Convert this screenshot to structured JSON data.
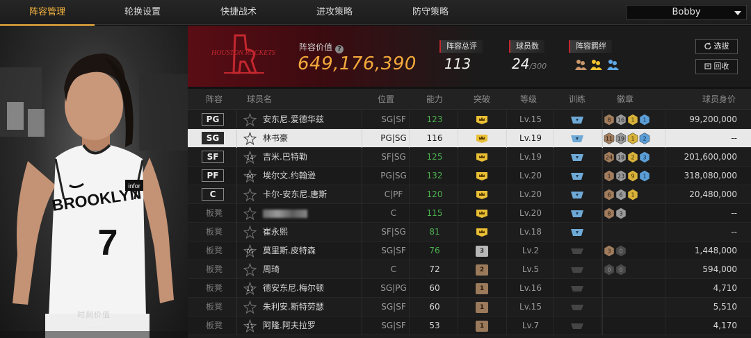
{
  "nav": {
    "tabs": [
      {
        "label": "阵容管理",
        "active": true
      },
      {
        "label": "轮换设置",
        "active": false
      },
      {
        "label": "快捷战术",
        "active": false
      },
      {
        "label": "进攻策略",
        "active": false
      },
      {
        "label": "防守策略",
        "active": false
      }
    ],
    "user": "Bobby"
  },
  "player_panel": {
    "jersey_text": "BROOKLYN",
    "jersey_number": "7",
    "logo_text": "infor",
    "value_label": "时刻价值",
    "value": "——"
  },
  "summary": {
    "logo_text": "HOUSTON ROCKETS",
    "value_title": "阵容价值",
    "value": "649,176,390",
    "overall_label": "阵容总评",
    "overall_value": "113",
    "players_label": "球员数",
    "players_value": "24",
    "players_max": "/300",
    "bond_label": "阵容羁绊",
    "btn_select": "选拔",
    "btn_recycle": "回收"
  },
  "table": {
    "headers": [
      "阵容",
      "球员名",
      "位置",
      "能力",
      "突破",
      "等级",
      "训练",
      "徽章",
      "球员身价"
    ],
    "rows": [
      {
        "slot": "PG",
        "num": "",
        "name": "安东尼.爱德华兹",
        "pos": "SG|SF",
        "rating": "123",
        "rating_color": "#4caf50",
        "breakthrough": "crown",
        "level": "Lv.15",
        "train": "blue",
        "badges": [
          [
            "8",
            "bronze"
          ],
          [
            "16",
            "silver"
          ],
          [
            "1",
            "gold"
          ],
          [
            "1",
            "blue"
          ]
        ],
        "value": "99,200,000"
      },
      {
        "slot": "SG",
        "num": "",
        "name": "林书豪",
        "pos": "PG|SG",
        "rating": "116",
        "rating_color": "#1a1a1a",
        "breakthrough": "crown",
        "level": "Lv.19",
        "train": "blue",
        "badges": [
          [
            "11",
            "bronze"
          ],
          [
            "19",
            "silver"
          ],
          [
            "1",
            "gold"
          ],
          [
            "2",
            "blue"
          ]
        ],
        "value": "--",
        "selected": true
      },
      {
        "slot": "SF",
        "num": "14",
        "name": "吉米.巴特勒",
        "pos": "SF|SG",
        "rating": "125",
        "rating_color": "#4caf50",
        "breakthrough": "crown",
        "level": "Lv.19",
        "train": "blue",
        "badges": [
          [
            "24",
            "bronze"
          ],
          [
            "18",
            "silver"
          ],
          [
            "2",
            "gold"
          ],
          [
            "3",
            "blue"
          ]
        ],
        "value": "201,600,000"
      },
      {
        "slot": "PF",
        "num": "90",
        "name": "埃尔文.约翰逊",
        "pos": "PG|SG",
        "rating": "132",
        "rating_color": "#4caf50",
        "breakthrough": "crown",
        "level": "Lv.20",
        "train": "blue",
        "badges": [
          [
            "1",
            "bronze"
          ],
          [
            "23",
            "silver"
          ],
          [
            "9",
            "gold"
          ],
          [
            "1",
            "blue"
          ]
        ],
        "value": "318,080,000"
      },
      {
        "slot": "C",
        "num": "",
        "name": "卡尔-安东尼.唐斯",
        "pos": "C|PF",
        "rating": "120",
        "rating_color": "#4caf50",
        "breakthrough": "crown",
        "level": "Lv.20",
        "train": "blue",
        "badges": [
          [
            "6",
            "bronze"
          ],
          [
            "6",
            "silver"
          ],
          [
            "1",
            "gold"
          ]
        ],
        "value": "20,480,000"
      },
      {
        "slot": "板凳",
        "num": "",
        "name": "",
        "blurred": true,
        "pos": "C",
        "rating": "115",
        "rating_color": "#4caf50",
        "breakthrough": "crown",
        "level": "Lv.20",
        "train": "blue",
        "badges": [
          [
            "8",
            "bronze"
          ],
          [
            "3",
            "silver"
          ]
        ],
        "value": "--"
      },
      {
        "slot": "板凳",
        "num": "",
        "name": "崔永熙",
        "pos": "SF|SG",
        "rating": "81",
        "rating_color": "#4caf50",
        "breakthrough": "crown",
        "level": "Lv.18",
        "train": "blue",
        "badges": [],
        "value": "--"
      },
      {
        "slot": "板凳",
        "num": "05",
        "name": "莫里斯.皮特森",
        "pos": "SG|SF",
        "rating": "76",
        "rating_color": "#4caf50",
        "breakthrough": "3",
        "bk_style": "silver",
        "level": "Lv.2",
        "train": "grey",
        "badges": [
          [
            "3",
            "bronze"
          ],
          [
            "0",
            "dark"
          ]
        ],
        "value": "1,448,000"
      },
      {
        "slot": "板凳",
        "num": "",
        "name": "周琦",
        "pos": "C",
        "rating": "72",
        "rating_color": "#d6d6d6",
        "breakthrough": "2",
        "bk_style": "bronze",
        "level": "Lv.5",
        "train": "grey",
        "badges": [
          [
            "0",
            "dark"
          ],
          [
            "0",
            "dark"
          ]
        ],
        "value": "594,000"
      },
      {
        "slot": "板凳",
        "num": "17",
        "name": "德安东尼.梅尔顿",
        "pos": "SG|PG",
        "rating": "60",
        "rating_color": "#d6d6d6",
        "breakthrough": "1",
        "bk_style": "bronze",
        "level": "Lv.16",
        "train": "grey",
        "badges": [],
        "value": "4,710"
      },
      {
        "slot": "板凳",
        "num": "",
        "name": "朱利安.斯特劳瑟",
        "pos": "SG|SF",
        "rating": "60",
        "rating_color": "#d6d6d6",
        "breakthrough": "1",
        "bk_style": "bronze",
        "level": "Lv.15",
        "train": "grey",
        "badges": [],
        "value": "5,510"
      },
      {
        "slot": "板凳",
        "num": "11",
        "name": "阿隆.阿夫拉罗",
        "pos": "SG|SF",
        "rating": "53",
        "rating_color": "#d6d6d6",
        "breakthrough": "1",
        "bk_style": "bronze",
        "level": "Lv.7",
        "train": "grey",
        "badges": [],
        "value": "4,170"
      }
    ]
  },
  "colors": {
    "accent": "#f2b23d",
    "team_red": "#c3272f",
    "value_orange": "#f4a93b",
    "rating_green": "#4caf50"
  }
}
